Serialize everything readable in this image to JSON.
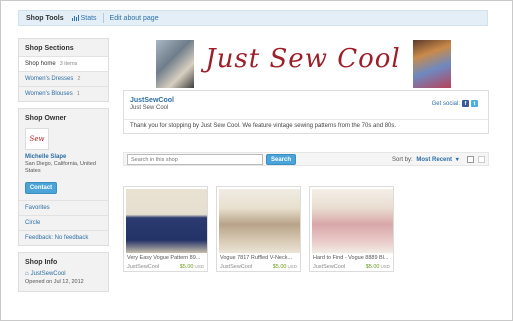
{
  "topbar": {
    "tools_label": "Shop Tools",
    "stats_label": "Stats",
    "edit_label": "Edit about page"
  },
  "sidebar": {
    "sections_title": "Shop Sections",
    "sections": [
      {
        "label": "Shop home",
        "count": "3 items"
      },
      {
        "label": "Women's Dresses",
        "count": "2"
      },
      {
        "label": "Women's Blouses",
        "count": "1"
      }
    ],
    "owner_title": "Shop Owner",
    "owner_avatar_text": "Sew",
    "owner_name": "Michelle Slape",
    "owner_location": "San Diego, California, United States",
    "contact_label": "Contact",
    "links": [
      "Favorites",
      "Circle",
      "Feedback: No feedback"
    ],
    "info_title": "Shop Info",
    "info_shop": "JustSewCool",
    "info_opened": "Opened on Jul 12, 2012"
  },
  "banner": {
    "logo_text": "Just Sew Cool"
  },
  "shop": {
    "name": "JustSewCool",
    "subtitle": "Just Sew Cool",
    "social_label": "Get social:",
    "announcement": "Thank you for stopping by Just Sew Cool. We feature vintage sewing patterns from the 70s and 80s."
  },
  "search": {
    "placeholder": "Search in this shop",
    "button_label": "Search",
    "sort_label": "Sort by:",
    "sort_value": "Most Recent"
  },
  "listings": [
    {
      "title": "Very Easy Vogue Pattern 89...",
      "shop": "JustSewCool",
      "price": "$5.00",
      "currency": "USD"
    },
    {
      "title": "Vogue 7817 Ruffled V-Neck...",
      "shop": "JustSewCool",
      "price": "$5.00",
      "currency": "USD"
    },
    {
      "title": "Hard to Find - Vogue 8889 Bl...",
      "shop": "JustSewCool",
      "price": "$5.00",
      "currency": "USD"
    }
  ],
  "colors": {
    "link": "#2f6fa5",
    "button": "#4aa4d8",
    "price": "#6a9a1f",
    "logo": "#9c1f2a"
  }
}
